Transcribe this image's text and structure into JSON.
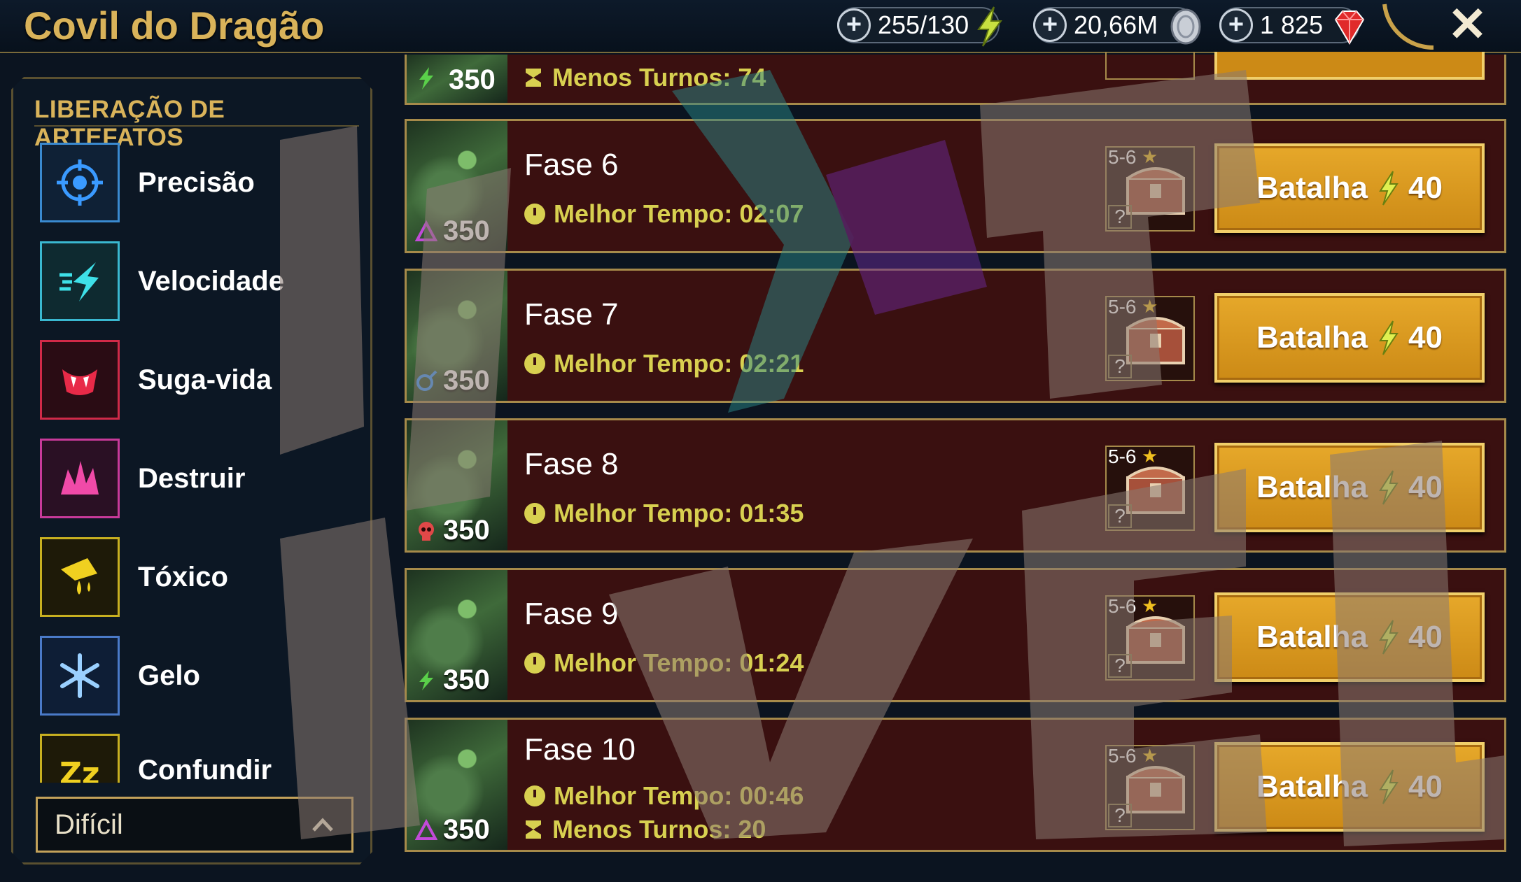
{
  "header": {
    "title": "Covil do Dragão",
    "energy": "255/130",
    "silver": "20,66M",
    "gems": "1 825"
  },
  "sidebar": {
    "title": "LIBERAÇÃO DE ARTEFATOS",
    "items": [
      {
        "label": "Precisão"
      },
      {
        "label": "Velocidade"
      },
      {
        "label": "Suga-vida"
      },
      {
        "label": "Destruir"
      },
      {
        "label": "Tóxico"
      },
      {
        "label": "Gelo"
      },
      {
        "label": "Confundir"
      }
    ],
    "difficulty": "Difícil"
  },
  "stages": {
    "partial": {
      "energy": "350",
      "turns": "Menos Turnos: 74"
    },
    "list": [
      {
        "name": "Fase 6",
        "energy": "350",
        "time": "Melhor Tempo: 02:07",
        "rank": "5-6",
        "battle": "Batalha",
        "cost": "40"
      },
      {
        "name": "Fase 7",
        "energy": "350",
        "time": "Melhor Tempo: 02:21",
        "rank": "5-6",
        "battle": "Batalha",
        "cost": "40"
      },
      {
        "name": "Fase 8",
        "energy": "350",
        "time": "Melhor Tempo: 01:35",
        "rank": "5-6",
        "battle": "Batalha",
        "cost": "40"
      },
      {
        "name": "Fase 9",
        "energy": "350",
        "time": "Melhor Tempo: 01:24",
        "rank": "5-6",
        "battle": "Batalha",
        "cost": "40"
      },
      {
        "name": "Fase 10",
        "energy": "350",
        "time": "Melhor Tempo: 00:46",
        "turns": "Menos Turnos: 20",
        "rank": "5-6",
        "battle": "Batalha",
        "cost": "40"
      }
    ]
  },
  "icons": {
    "energy": "lightning-icon",
    "silver": "silver-coin-icon",
    "gems": "ruby-icon",
    "close": "close-icon"
  }
}
